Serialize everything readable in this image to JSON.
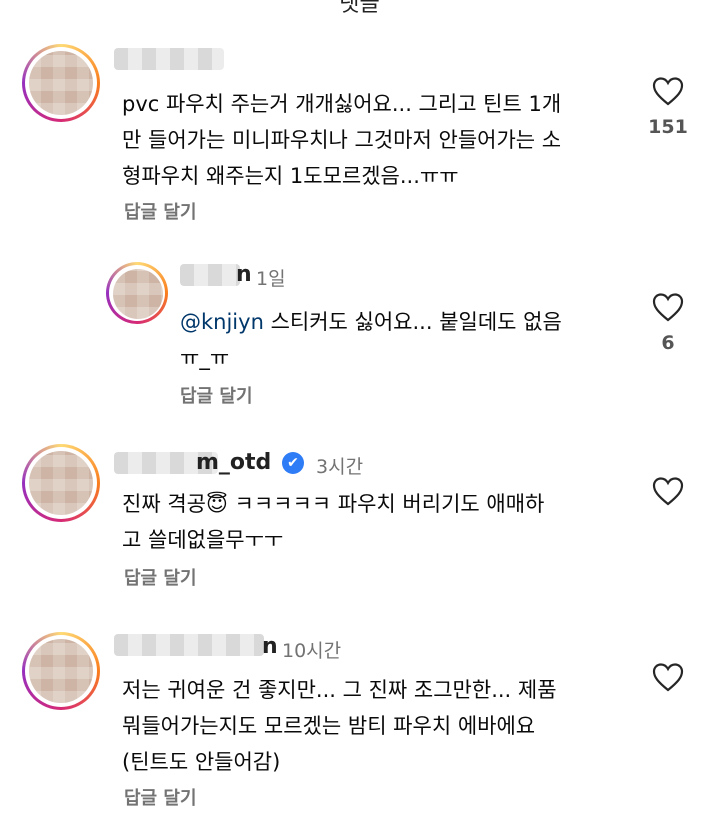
{
  "header_peek": "댓글",
  "comments": [
    {
      "timeago": "",
      "text_lines": [
        "pvc 파우치 주는거 개개싫어요... 그리고 틴트 1개",
        "만 들어가는 미니파우치나 그것마저 안들어가는 소",
        "형파우치 왜주는지 1도모르겠음...ㅠㅠ"
      ],
      "reply_label": "답글 달기",
      "likes": "151"
    },
    {
      "username_suffix": "n",
      "timeago": "1일",
      "mention": "@knjiyn",
      "text_lines": [
        "스티커도 싫어요... 붙일데도 없음",
        "ㅠ_ㅠ"
      ],
      "reply_label": "답글 달기",
      "likes": "6"
    },
    {
      "username_suffix": "m_otd",
      "verified": "✔",
      "timeago": "3시간",
      "text_lines": [
        "진짜 격공😇 ㅋㅋㅋㅋㅋ 파우치 버리기도 애매하",
        "고 쓸데없을무ㅜㅜ"
      ],
      "reply_label": "답글 달기",
      "likes": ""
    },
    {
      "username_suffix": "n",
      "timeago": "10시간",
      "text_lines": [
        "저는 귀여운 건 좋지만... 그 진짜 조그만한... 제품",
        "뭐들어가는지도 모르겠는 밤티 파우치 에바에요",
        "(틴트도 안들어감)"
      ],
      "reply_label": "답글 달기",
      "likes": ""
    }
  ],
  "colors": {
    "link": "#00376b",
    "meta": "#737373",
    "verified": "#2e7cf6"
  }
}
